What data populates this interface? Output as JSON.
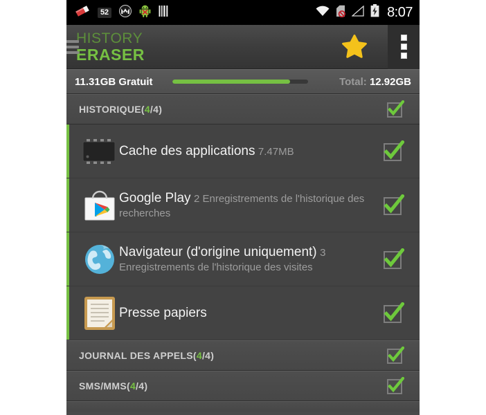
{
  "statusbar": {
    "icons": [
      {
        "name": "eraser-icon",
        "label": "eraser"
      },
      {
        "name": "notification-count-badge",
        "label": "52"
      },
      {
        "name": "motorola-logo-icon",
        "label": "M"
      },
      {
        "name": "android-robot-error-icon",
        "label": "android"
      },
      {
        "name": "barcode-icon",
        "label": "barcode"
      }
    ],
    "right_icons": [
      {
        "name": "wifi-icon",
        "label": "wifi"
      },
      {
        "name": "sdcard-removed-icon",
        "label": "sd card removed"
      },
      {
        "name": "signal-icon",
        "label": "signal"
      },
      {
        "name": "battery-charging-icon",
        "label": "battery"
      }
    ],
    "badge_count": "52",
    "time": "8:07"
  },
  "appbar": {
    "brand_line1": "HISTORY",
    "brand_line2": "ERASER",
    "menu_icon": "hamburger-icon",
    "star_icon": "star-icon",
    "overflow_icon": "overflow-menu-icon"
  },
  "storage": {
    "free_label": "11.31GB Gratuit",
    "total_word": "Total:",
    "total_value": "12.92GB",
    "progress_percent": 87
  },
  "sections": [
    {
      "id": "historique",
      "title_prefix": "HISTORIQUE(",
      "title_count": "4",
      "title_suffix": "/4)",
      "checked": true,
      "items": [
        {
          "title": "Cache des applications",
          "subtitle": "7.47MB",
          "icon": "chip-icon",
          "checked": true
        },
        {
          "title": "Google Play",
          "subtitle": "2 Enregistrements de l'historique des recherches",
          "icon": "google-play-icon",
          "checked": true
        },
        {
          "title": "Navigateur (d'origine uniquement)",
          "subtitle": "3 Enregistrements de l'historique des visites",
          "icon": "globe-icon",
          "checked": true
        },
        {
          "title": "Presse papiers",
          "subtitle": "",
          "icon": "clipboard-icon",
          "checked": true
        }
      ]
    },
    {
      "id": "journal-des-appels",
      "title_prefix": "JOURNAL DES APPELS(",
      "title_count": "4",
      "title_suffix": "/4)",
      "checked": true,
      "items": []
    },
    {
      "id": "sms-mms",
      "title_prefix": "SMS/MMS(",
      "title_count": "4",
      "title_suffix": "/4)",
      "checked": true,
      "items": []
    }
  ],
  "colors": {
    "accent_green": "#76c043",
    "brand_green_dark": "#5d8f3b",
    "star_yellow": "#f4c21b",
    "panel_bg": "#434343"
  }
}
